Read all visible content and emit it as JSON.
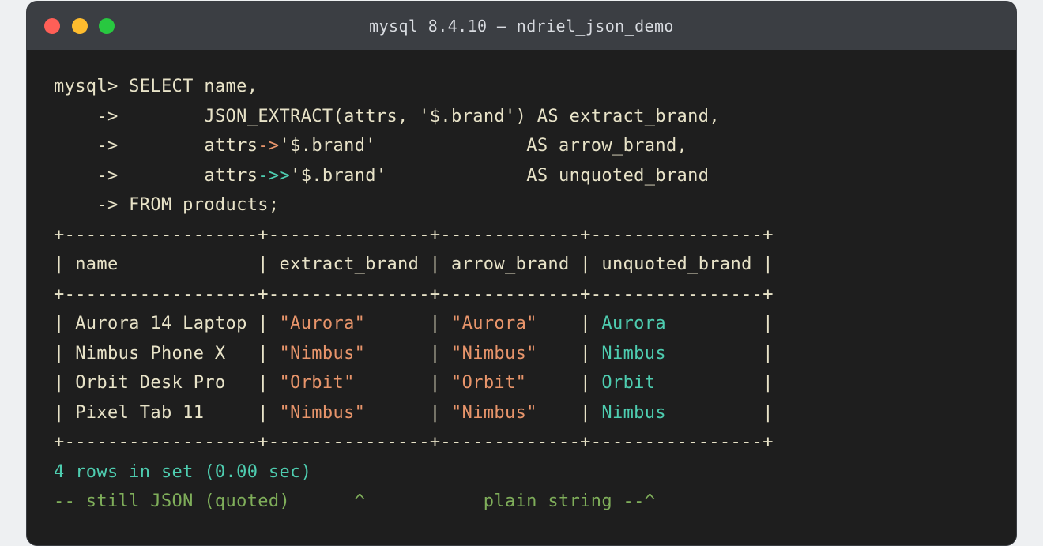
{
  "window": {
    "title": "mysql 8.4.10 — ndriel_json_demo"
  },
  "colors": {
    "text": "#e8e3c8",
    "json_string": "#e8956b",
    "plain_string": "#4ecdb0",
    "comment": "#7fae5a",
    "close": "#ff5f57",
    "minimize": "#febc2e",
    "maximize": "#28c840"
  },
  "query": {
    "prompt": "mysql> ",
    "line1": "SELECT name,",
    "cont_prefix": "    ->        ",
    "line2": "JSON_EXTRACT(attrs, '$.brand') AS extract_brand,",
    "line3_a": "attrs",
    "line3_op": "->",
    "line3_b": "'$.brand'              AS arrow_brand,",
    "line4_a": "attrs",
    "line4_op": "->>",
    "line4_b": "'$.brand'             AS unquoted_brand",
    "line5": "    -> FROM products;"
  },
  "table": {
    "border": "+------------------+---------------+-------------+----------------+",
    "header": "| name             | extract_brand | arrow_brand | unquoted_brand |",
    "rows": [
      {
        "name": "| Aurora 14 Laptop | ",
        "extract": "\"Aurora\"",
        "pad1": "      | ",
        "arrow": "\"Aurora\"",
        "pad2": "    | ",
        "unquoted": "Aurora",
        "pad3": "         |"
      },
      {
        "name": "| Nimbus Phone X   | ",
        "extract": "\"Nimbus\"",
        "pad1": "      | ",
        "arrow": "\"Nimbus\"",
        "pad2": "    | ",
        "unquoted": "Nimbus",
        "pad3": "         |"
      },
      {
        "name": "| Orbit Desk Pro   | ",
        "extract": "\"Orbit\"",
        "pad1": "       | ",
        "arrow": "\"Orbit\"",
        "pad2": "     | ",
        "unquoted": "Orbit",
        "pad3": "          |"
      },
      {
        "name": "| Pixel Tab 11     | ",
        "extract": "\"Nimbus\"",
        "pad1": "      | ",
        "arrow": "\"Nimbus\"",
        "pad2": "    | ",
        "unquoted": "Nimbus",
        "pad3": "         |"
      }
    ]
  },
  "status": "4 rows in set (0.00 sec)",
  "annotation": "-- still JSON (quoted)      ^           plain string --^"
}
